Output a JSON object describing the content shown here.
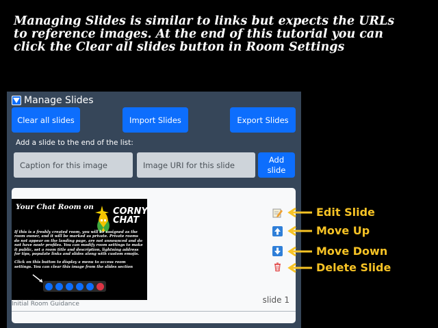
{
  "tutorial": {
    "line1": "Managing Slides is similar to links but expects the URLs",
    "line2": "to reference images.  At the end of this tutorial you can",
    "line3": "click the Clear all slides button in Room Settings"
  },
  "panel": {
    "title": "Manage Slides",
    "clear_label": "Clear all slides",
    "import_label": "Import Slides",
    "export_label": "Export Slides",
    "add_prompt": "Add a slide to the end of the list:",
    "caption_placeholder": "Caption for this image",
    "uri_placeholder": "Image URI for this slide",
    "add_label_1": "Add",
    "add_label_2": "slide"
  },
  "slide": {
    "thumb_title": "Your Chat Room on",
    "brand_1": "CORNY",
    "brand_2": "CHAT",
    "body_1": "If this is a freshly created room, you will be assigned as the room owner, and it will be marked as private. Private rooms do not appear on the landing page, are not announced and do not have nostr profiles. You can modify room settings to make it public, set a room title and description, lightning address for tips, populate links and slides along with custom emojis.",
    "body_2": "Click on this button to display a menu to access room settings.  You can clear this image from the slides section",
    "caption": "Initial Room Guidance",
    "number": "slide 1"
  },
  "callouts": {
    "edit": "Edit Slide",
    "up": "Move Up",
    "down": "Move Down",
    "delete": "Delete Slide"
  },
  "colors": {
    "accent": "#0d6efd",
    "panel_bg": "#364659",
    "callout": "#f7c325"
  }
}
